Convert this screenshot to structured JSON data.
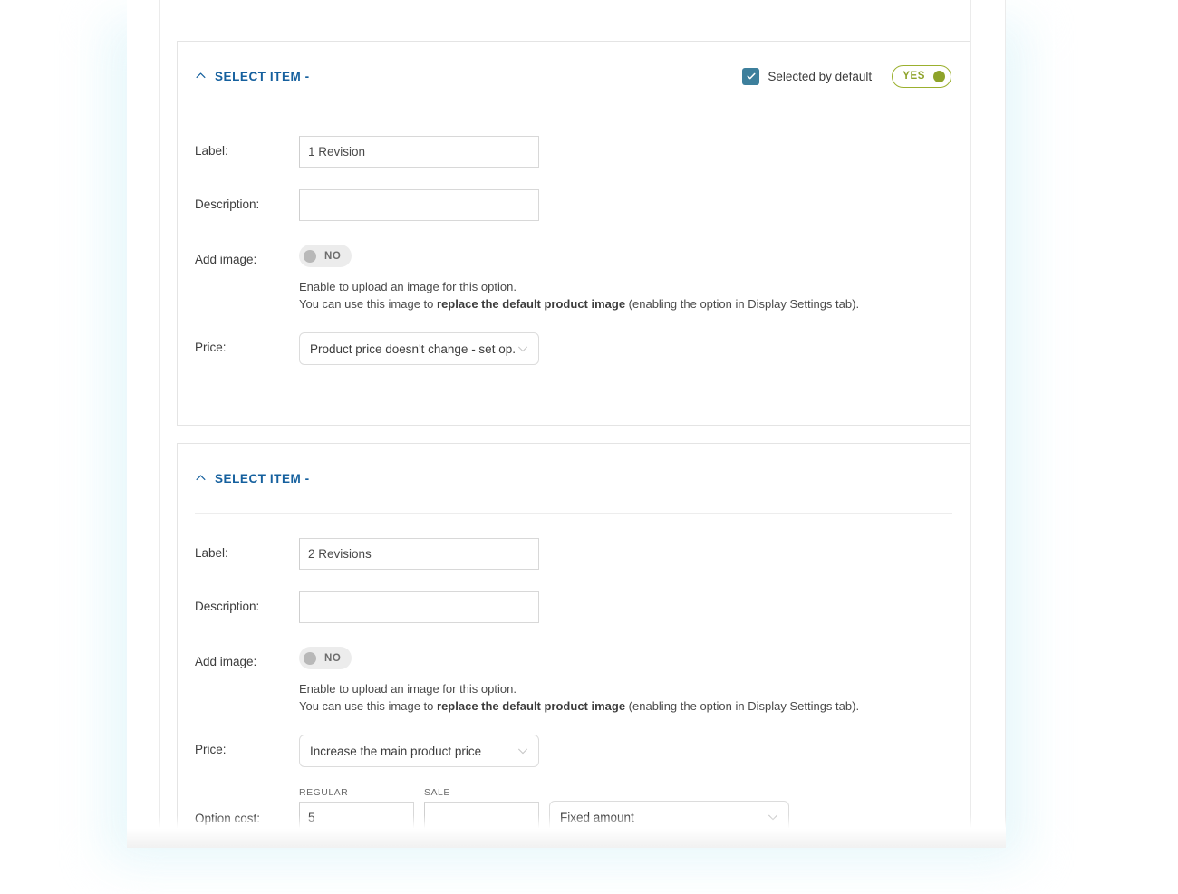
{
  "theme": {
    "accent_blue": "#15609e",
    "checkbox_teal": "#3d7f9c",
    "toggle_on_green": "#8ea32a",
    "toggle_off_gray": "#b8b8b8"
  },
  "panels": [
    {
      "title": "SELECT ITEM -",
      "collapse_icon": "chevron-up-icon",
      "selected_by_default": {
        "label": "Selected by default",
        "checked": true,
        "toggle": {
          "value": "YES",
          "on": true
        }
      },
      "fields": {
        "label_caption": "Label:",
        "label_value": "1 Revision",
        "description_caption": "Description:",
        "description_value": "",
        "add_image_caption": "Add image:",
        "add_image_toggle": {
          "value": "NO",
          "on": false
        },
        "help_line_1": "Enable to upload an image for this option.",
        "help_line_2_pre": "You can use this image to ",
        "help_line_2_bold": "replace the default product image",
        "help_line_2_post": " (enabling the option in Display Settings tab).",
        "price_caption": "Price:",
        "price_value": "Product price doesn't change - set op..."
      }
    },
    {
      "title": "SELECT ITEM -",
      "collapse_icon": "chevron-up-icon",
      "fields": {
        "label_caption": "Label:",
        "label_value": "2 Revisions",
        "description_caption": "Description:",
        "description_value": "",
        "add_image_caption": "Add image:",
        "add_image_toggle": {
          "value": "NO",
          "on": false
        },
        "help_line_1": "Enable to upload an image for this option.",
        "help_line_2_pre": "You can use this image to ",
        "help_line_2_bold": "replace the default product image",
        "help_line_2_post": " (enabling the option in Display Settings tab).",
        "price_caption": "Price:",
        "price_value": "Increase the main product price",
        "option_cost_caption": "Option cost:",
        "cost_regular_caption": "REGULAR",
        "cost_regular_value": "5",
        "cost_sale_caption": "SALE",
        "cost_sale_value": "",
        "cost_type_value": "Fixed amount"
      }
    }
  ]
}
